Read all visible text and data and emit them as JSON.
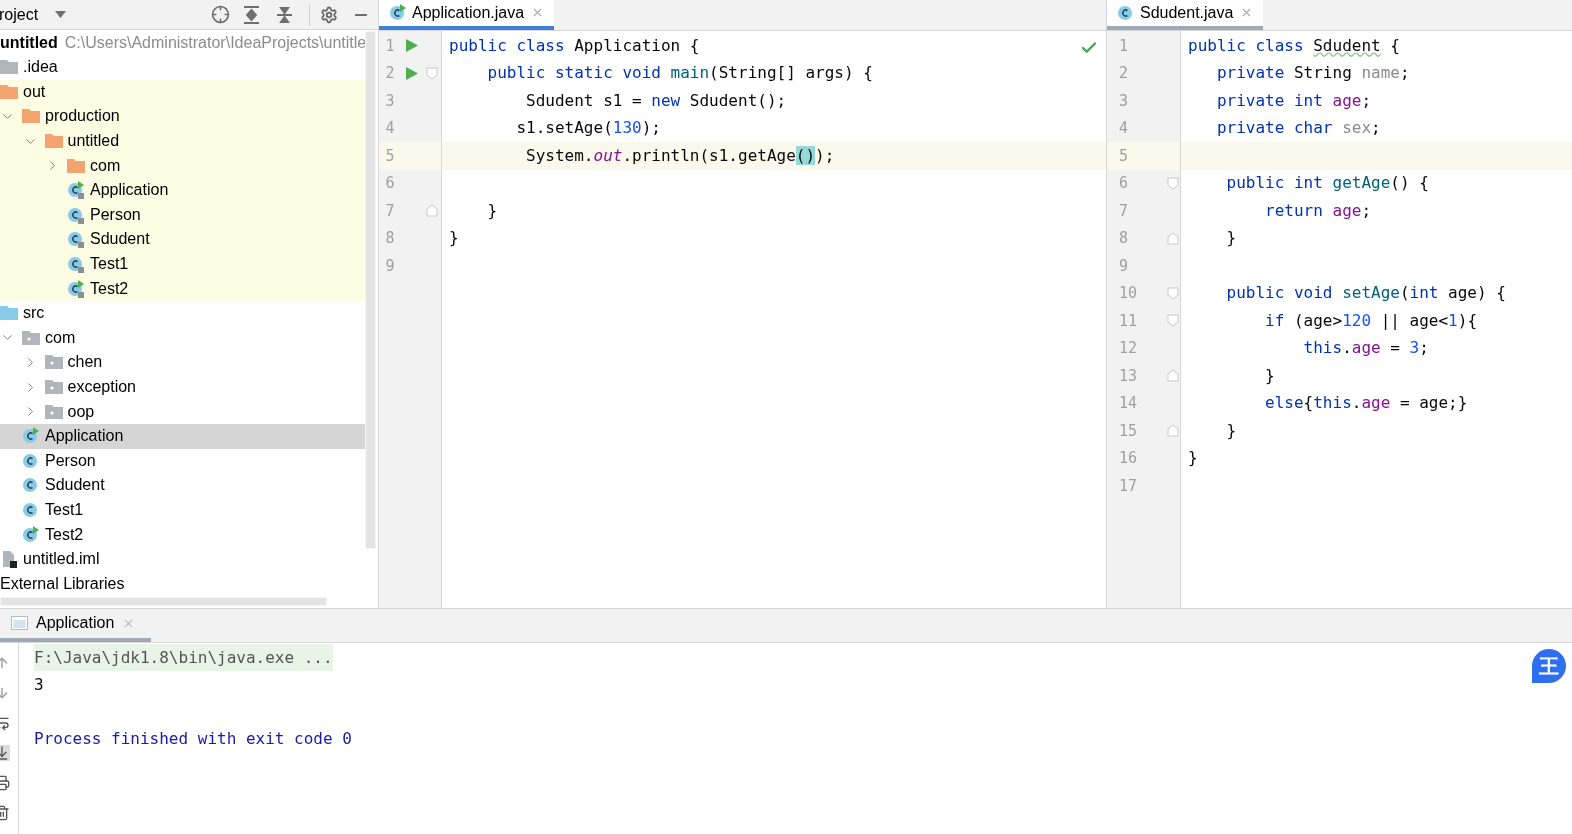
{
  "project_panel": {
    "title": "roject",
    "root": {
      "label": "untitled",
      "path": "C:\\Users\\Administrator\\IdeaProjects\\untitle"
    },
    "tree": [
      {
        "label": ".idea",
        "kind": "folder",
        "color": "#afb5bb",
        "selected": false
      },
      {
        "label": "out",
        "kind": "folder",
        "color": "#f4a46e",
        "highlighted": true,
        "selected": false,
        "children": [
          {
            "label": "production",
            "kind": "folder",
            "color": "#f4a46e",
            "expanded": true,
            "selected": false,
            "children": [
              {
                "label": "untitled",
                "kind": "folder",
                "color": "#f4a46e",
                "expanded": true,
                "selected": false,
                "children": [
                  {
                    "label": "com",
                    "kind": "folder",
                    "color": "#f4a46e",
                    "expanded": false,
                    "selected": false
                  },
                  {
                    "label": "Application",
                    "kind": "class",
                    "runnable": true,
                    "locked": true,
                    "selected": false
                  },
                  {
                    "label": "Person",
                    "kind": "class",
                    "runnable": false,
                    "locked": true,
                    "selected": false
                  },
                  {
                    "label": "Sdudent",
                    "kind": "class",
                    "runnable": false,
                    "locked": true,
                    "selected": false
                  },
                  {
                    "label": "Test1",
                    "kind": "class",
                    "runnable": false,
                    "locked": true,
                    "selected": false
                  },
                  {
                    "label": "Test2",
                    "kind": "class",
                    "runnable": true,
                    "locked": true,
                    "selected": false
                  }
                ]
              }
            ]
          }
        ]
      },
      {
        "label": "src",
        "kind": "folder",
        "color": "#87cbe8",
        "selected": false,
        "children": [
          {
            "label": "com",
            "kind": "package",
            "expanded": true,
            "selected": false,
            "children": [
              {
                "label": "chen",
                "kind": "package",
                "expanded": false,
                "selected": false
              },
              {
                "label": "exception",
                "kind": "package",
                "expanded": false,
                "selected": false
              },
              {
                "label": "oop",
                "kind": "package",
                "expanded": false,
                "selected": false
              }
            ]
          },
          {
            "label": "Application",
            "kind": "class",
            "runnable": true,
            "locked": false,
            "selected": true
          },
          {
            "label": "Person",
            "kind": "class",
            "runnable": false,
            "locked": false,
            "selected": false
          },
          {
            "label": "Sdudent",
            "kind": "class",
            "runnable": false,
            "locked": false,
            "selected": false
          },
          {
            "label": "Test1",
            "kind": "class",
            "runnable": false,
            "locked": false,
            "selected": false
          },
          {
            "label": "Test2",
            "kind": "class",
            "runnable": true,
            "locked": false,
            "selected": false
          }
        ]
      },
      {
        "label": "untitled.iml",
        "kind": "file",
        "selected": false
      },
      {
        "label": "External Libraries",
        "kind": "library",
        "selected": false
      }
    ]
  },
  "editors": [
    {
      "tab": {
        "label": "Application.java",
        "runnable": true,
        "selected": true
      },
      "focused": true,
      "no_problems": true,
      "lines": [
        {
          "number": "1",
          "run": true,
          "tokens": [
            {
              "kind": "kw",
              "text": "public class "
            },
            {
              "kind": "plain",
              "text": "Application {"
            }
          ]
        },
        {
          "number": "2",
          "run": true,
          "fold_open": true,
          "tokens": [
            {
              "kind": "kw",
              "text": "    public static void "
            },
            {
              "kind": "fn",
              "text": "main"
            },
            {
              "kind": "plain",
              "text": "(String[] args) {"
            }
          ]
        },
        {
          "number": "3",
          "tokens": [
            {
              "kind": "plain",
              "text": "        Sdudent s1 = "
            },
            {
              "kind": "kw",
              "text": "new "
            },
            {
              "kind": "plain",
              "text": "Sdudent();"
            }
          ]
        },
        {
          "number": "4",
          "tokens": [
            {
              "kind": "plain",
              "text": "       s1.setAge("
            },
            {
              "kind": "num",
              "text": "130"
            },
            {
              "kind": "plain",
              "text": ");"
            }
          ]
        },
        {
          "number": "5",
          "current": true,
          "tokens": [
            {
              "kind": "plain",
              "text": "        System."
            },
            {
              "kind": "static",
              "text": "out"
            },
            {
              "kind": "plain",
              "text": ".println(s1.getAge"
            },
            {
              "kind": "match",
              "text": "()"
            },
            {
              "kind": "plain",
              "text": ");"
            }
          ]
        },
        {
          "number": "6"
        },
        {
          "number": "7",
          "fold_close": true,
          "tokens": [
            {
              "kind": "plain",
              "text": "    }"
            }
          ]
        },
        {
          "number": "8",
          "tokens": [
            {
              "kind": "plain",
              "text": "}"
            }
          ]
        },
        {
          "number": "9"
        }
      ]
    },
    {
      "tab": {
        "label": "Sdudent.java",
        "runnable": false,
        "selected": true
      },
      "focused": false,
      "lines": [
        {
          "number": "1",
          "tokens": [
            {
              "kind": "kw",
              "text": "public class "
            },
            {
              "kind": "warn",
              "text": "Sdudent"
            },
            {
              "kind": "plain",
              "text": " {"
            }
          ]
        },
        {
          "number": "2",
          "tokens": [
            {
              "kind": "kw",
              "text": "   private "
            },
            {
              "kind": "plain",
              "text": "String "
            },
            {
              "kind": "unused",
              "text": "name"
            },
            {
              "kind": "plain",
              "text": ";"
            }
          ]
        },
        {
          "number": "3",
          "tokens": [
            {
              "kind": "kw",
              "text": "   private int "
            },
            {
              "kind": "field",
              "text": "age"
            },
            {
              "kind": "plain",
              "text": ";"
            }
          ]
        },
        {
          "number": "4",
          "tokens": [
            {
              "kind": "kw",
              "text": "   private char "
            },
            {
              "kind": "unused",
              "text": "sex"
            },
            {
              "kind": "plain",
              "text": ";"
            }
          ]
        },
        {
          "number": "5",
          "current": true
        },
        {
          "number": "6",
          "fold_open": true,
          "tokens": [
            {
              "kind": "kw",
              "text": "    public int "
            },
            {
              "kind": "fn",
              "text": "getAge"
            },
            {
              "kind": "plain",
              "text": "() {"
            }
          ]
        },
        {
          "number": "7",
          "tokens": [
            {
              "kind": "kw",
              "text": "        return "
            },
            {
              "kind": "field",
              "text": "age"
            },
            {
              "kind": "plain",
              "text": ";"
            }
          ]
        },
        {
          "number": "8",
          "fold_close": true,
          "tokens": [
            {
              "kind": "plain",
              "text": "    }"
            }
          ]
        },
        {
          "number": "9"
        },
        {
          "number": "10",
          "fold_open": true,
          "tokens": [
            {
              "kind": "kw",
              "text": "    public void "
            },
            {
              "kind": "fn",
              "text": "setAge"
            },
            {
              "kind": "plain",
              "text": "("
            },
            {
              "kind": "kw",
              "text": "int "
            },
            {
              "kind": "plain",
              "text": "age) {"
            }
          ]
        },
        {
          "number": "11",
          "fold_open": true,
          "tokens": [
            {
              "kind": "kw",
              "text": "        if "
            },
            {
              "kind": "plain",
              "text": "(age>"
            },
            {
              "kind": "num",
              "text": "120"
            },
            {
              "kind": "plain",
              "text": " || age<"
            },
            {
              "kind": "num",
              "text": "1"
            },
            {
              "kind": "plain",
              "text": "){"
            }
          ]
        },
        {
          "number": "12",
          "tokens": [
            {
              "kind": "kw",
              "text": "            this"
            },
            {
              "kind": "plain",
              "text": "."
            },
            {
              "kind": "field",
              "text": "age"
            },
            {
              "kind": "plain",
              "text": " = "
            },
            {
              "kind": "num",
              "text": "3"
            },
            {
              "kind": "plain",
              "text": ";"
            }
          ]
        },
        {
          "number": "13",
          "fold_close": true,
          "tokens": [
            {
              "kind": "plain",
              "text": "        }"
            }
          ]
        },
        {
          "number": "14",
          "tokens": [
            {
              "kind": "kw",
              "text": "        else"
            },
            {
              "kind": "plain",
              "text": "{"
            },
            {
              "kind": "kw",
              "text": "this"
            },
            {
              "kind": "plain",
              "text": "."
            },
            {
              "kind": "field",
              "text": "age"
            },
            {
              "kind": "plain",
              "text": " = age;}"
            }
          ]
        },
        {
          "number": "15",
          "fold_close": true,
          "tokens": [
            {
              "kind": "plain",
              "text": "    }"
            }
          ]
        },
        {
          "number": "16",
          "tokens": [
            {
              "kind": "plain",
              "text": "}"
            }
          ]
        },
        {
          "number": "17"
        }
      ]
    }
  ],
  "run_panel": {
    "tab": {
      "label": "Application",
      "selected": true
    },
    "console": [
      {
        "kind": "command",
        "text": "F:\\Java\\jdk1.8\\bin\\java.exe ..."
      },
      {
        "kind": "output",
        "text": "3"
      },
      {
        "kind": "exit",
        "text": "Process finished with exit code 0"
      }
    ],
    "ime_badge": {
      "label": "王"
    }
  }
}
